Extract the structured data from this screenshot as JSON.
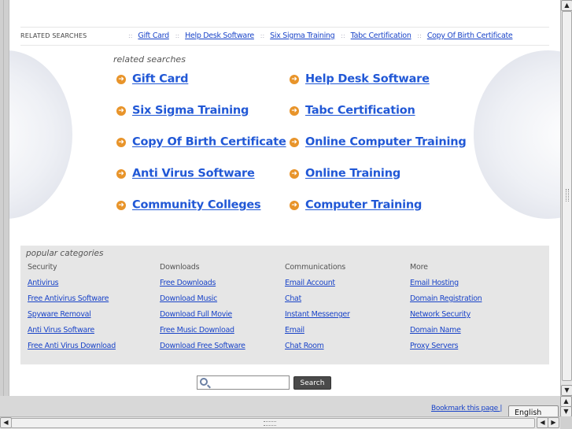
{
  "related_bar": {
    "label": "RELATED SEARCHES",
    "separator": "::",
    "links": [
      "Gift Card",
      "Help Desk Software",
      "Six Sigma Training",
      "Tabc Certification",
      "Copy Of Birth Certificate"
    ]
  },
  "related_searches": {
    "title": "related searches",
    "arrow_icon": "orange-circle-arrow-icon",
    "accent_color": "#e8942a",
    "left": [
      "Gift Card",
      "Six Sigma Training",
      "Copy Of Birth Certificate",
      "Anti Virus Software",
      "Community Colleges"
    ],
    "right": [
      "Help Desk Software",
      "Tabc Certification",
      "Online Computer Training",
      "Online Training",
      "Computer Training"
    ]
  },
  "popular": {
    "title": "popular categories",
    "columns": [
      {
        "head": "Security",
        "links": [
          "Antivirus",
          "Free Antivirus Software",
          "Spyware Removal",
          "Anti Virus Software",
          "Free Anti Virus Download"
        ]
      },
      {
        "head": "Downloads",
        "links": [
          "Free Downloads",
          "Download Music",
          "Download Full Movie",
          "Free Music Download",
          "Download Free Software"
        ]
      },
      {
        "head": "Communications",
        "links": [
          "Email Account",
          "Chat",
          "Instant Messenger",
          "Email",
          "Chat Room"
        ]
      },
      {
        "head": "More",
        "links": [
          "Email Hosting",
          "Domain Registration",
          "Network Security",
          "Domain Name",
          "Proxy Servers"
        ]
      }
    ]
  },
  "search": {
    "value": "",
    "button_label": "Search"
  },
  "footer": {
    "bookmark_label": "Bookmark this page |",
    "language": "English"
  },
  "scrollbar": {
    "up": "▲",
    "down": "▼",
    "left": "◀",
    "right": "▶"
  }
}
